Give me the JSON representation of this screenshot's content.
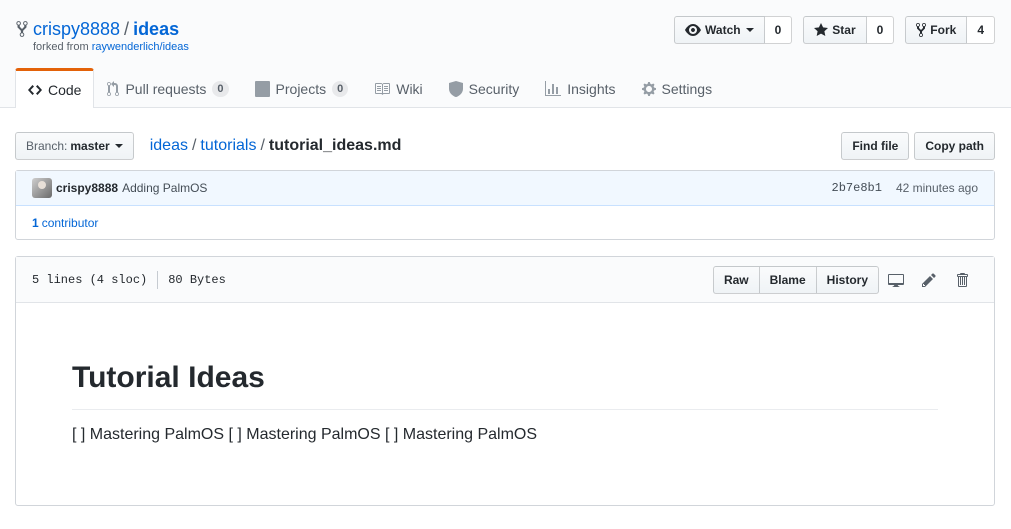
{
  "repo": {
    "owner": "crispy8888",
    "separator": "/",
    "name": "ideas",
    "forked_prefix": "forked from ",
    "forked_source": "raywenderlich/ideas"
  },
  "actions": {
    "watch_label": "Watch",
    "watch_count": "0",
    "star_label": "Star",
    "star_count": "0",
    "fork_label": "Fork",
    "fork_count": "4"
  },
  "tabs": [
    {
      "label": "Code",
      "icon": "code-icon",
      "selected": true
    },
    {
      "label": "Pull requests",
      "icon": "pull-request-icon",
      "counter": "0"
    },
    {
      "label": "Projects",
      "icon": "project-icon",
      "counter": "0"
    },
    {
      "label": "Wiki",
      "icon": "book-icon"
    },
    {
      "label": "Security",
      "icon": "shield-icon"
    },
    {
      "label": "Insights",
      "icon": "graph-icon"
    },
    {
      "label": "Settings",
      "icon": "gear-icon"
    }
  ],
  "file_nav": {
    "branch_label": "Branch:",
    "branch_value": "master",
    "breadcrumb": [
      "ideas",
      "tutorials",
      "tutorial_ideas.md"
    ],
    "breadcrumb_sep": "/",
    "find_file": "Find file",
    "copy_path": "Copy path"
  },
  "commit": {
    "author": "crispy8888",
    "message": "Adding PalmOS",
    "sha": "2b7e8b1",
    "time": "42 minutes ago",
    "contributor_count": "1",
    "contributor_label": "contributor"
  },
  "file": {
    "lines": "5 lines (4 sloc)",
    "size": "80 Bytes",
    "raw": "Raw",
    "blame": "Blame",
    "history": "History"
  },
  "content": {
    "heading": "Tutorial Ideas",
    "body": "[ ] Mastering PalmOS [ ] Mastering PalmOS [ ] Mastering PalmOS"
  },
  "colors": {
    "link": "#0366d6",
    "tab_accent": "#e36209",
    "commit_bg": "#f1f8ff"
  }
}
